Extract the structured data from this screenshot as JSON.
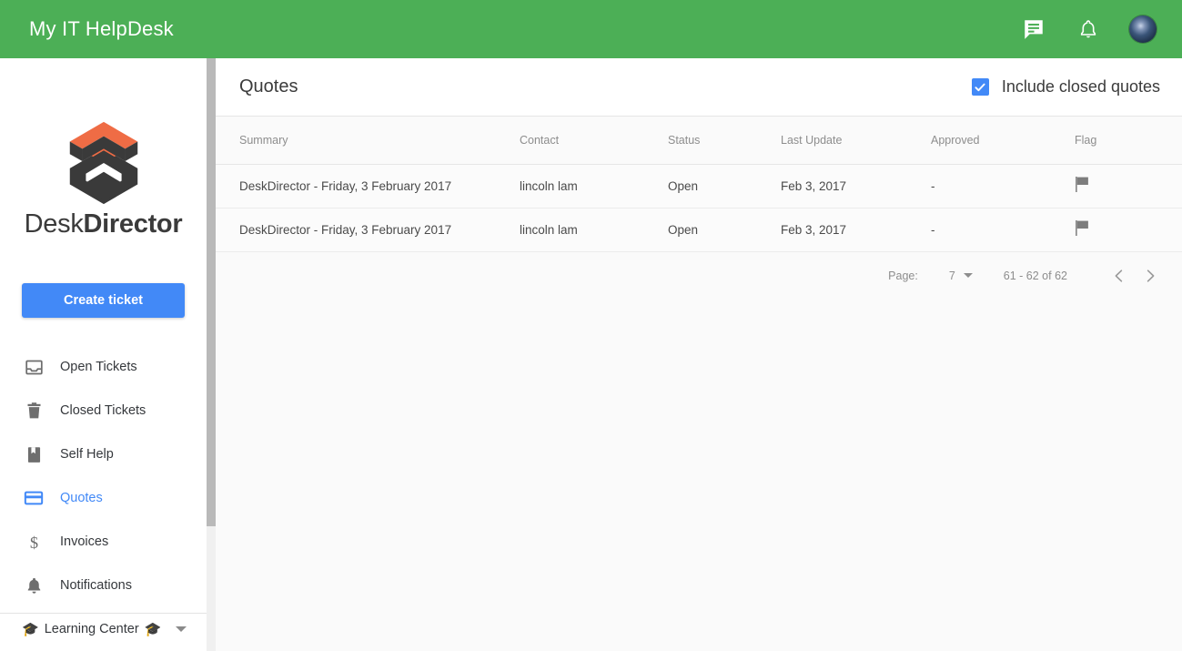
{
  "topbar": {
    "app_title": "My IT HelpDesk",
    "bg_color": "#4caf56",
    "icons": [
      {
        "name": "messages-icon",
        "label": "Messages"
      },
      {
        "name": "notifications-bell-icon",
        "label": "Notifications"
      },
      {
        "name": "user-avatar",
        "label": "Account"
      }
    ]
  },
  "sidebar": {
    "logo": {
      "name_light": "Desk",
      "name_bold": "Director",
      "mark_color": "#ef6c45",
      "body_color": "#3a3a3a"
    },
    "create_ticket_label": "Create ticket",
    "create_ticket_color": "#4289f7",
    "items": [
      {
        "label": "Open Tickets",
        "icon": "inbox-icon",
        "active": false
      },
      {
        "label": "Closed Tickets",
        "icon": "trash-icon",
        "active": false
      },
      {
        "label": "Self Help",
        "icon": "bookmark-icon",
        "active": false
      },
      {
        "label": "Quotes",
        "icon": "card-icon",
        "active": true
      },
      {
        "label": "Invoices",
        "icon": "dollar-icon",
        "active": false
      },
      {
        "label": "Notifications",
        "icon": "bell-icon",
        "active": false
      }
    ],
    "active_color": "#4289f7",
    "learning_center": {
      "label": "Learning Center",
      "icon": "graduation-cap-icon"
    }
  },
  "main": {
    "page_title": "Quotes",
    "include_closed": {
      "label": "Include closed quotes",
      "checked": true,
      "color": "#4289f7"
    },
    "table": {
      "columns": [
        "Summary",
        "Contact",
        "Status",
        "Last Update",
        "Approved",
        "Flag"
      ],
      "rows": [
        {
          "summary": "DeskDirector - Friday, 3 February 2017",
          "contact": "lincoln lam",
          "status": "Open",
          "last_update": "Feb 3, 2017",
          "approved": "-",
          "flag": "flag-icon"
        },
        {
          "summary": "DeskDirector - Friday, 3 February 2017",
          "contact": "lincoln lam",
          "status": "Open",
          "last_update": "Feb 3, 2017",
          "approved": "-",
          "flag": "flag-icon"
        }
      ]
    },
    "pagination": {
      "page_label": "Page:",
      "page_value": "7",
      "range": "61 - 62 of 62",
      "prev": "prev-page-icon",
      "next": "next-page-icon"
    }
  }
}
